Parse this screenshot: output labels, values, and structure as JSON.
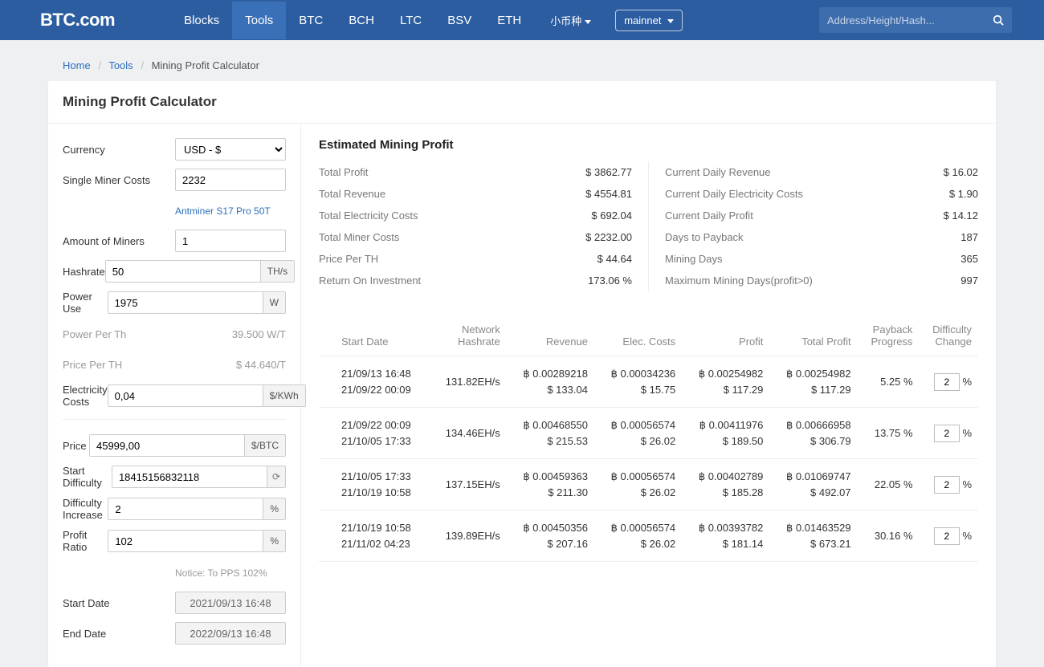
{
  "nav": {
    "logo": "BTC.com",
    "items": [
      "Blocks",
      "Tools",
      "BTC",
      "BCH",
      "LTC",
      "BSV",
      "ETH"
    ],
    "active_index": 1,
    "small_coins": "小币种",
    "network": "mainnet",
    "search_placeholder": "Address/Height/Hash..."
  },
  "crumbs": {
    "home": "Home",
    "tools": "Tools",
    "current": "Mining Profit Calculator"
  },
  "page_title": "Mining Profit Calculator",
  "form": {
    "labels": {
      "currency": "Currency",
      "single_miner_costs": "Single Miner Costs",
      "amount_of_miners": "Amount of Miners",
      "hashrate": "Hashrate",
      "power_use": "Power Use",
      "power_per_th": "Power Per Th",
      "price_per_th": "Price Per TH",
      "electricity_costs": "Electricity Costs",
      "price": "Price",
      "start_difficulty": "Start Difficulty",
      "difficulty_increase": "Difficulty Increase",
      "profit_ratio": "Profit Ratio",
      "start_date": "Start Date",
      "end_date": "End Date"
    },
    "units": {
      "ths": "TH/s",
      "w": "W",
      "kwh": "$/KWh",
      "btc": "$/BTC",
      "pct": "%"
    },
    "values": {
      "currency": "USD - $",
      "single_miner_costs": "2232",
      "amount_of_miners": "1",
      "hashrate": "50",
      "power_use": "1975",
      "power_per_th": "39.500 W/T",
      "price_per_th": "$ 44.640/T",
      "electricity_costs": "0,04",
      "price": "45999,00",
      "start_difficulty": "18415156832118",
      "difficulty_increase": "2",
      "profit_ratio": "102",
      "start_date": "2021/09/13 16:48",
      "end_date": "2022/09/13 16:48"
    },
    "miner_link": "Antminer S17 Pro 50T",
    "notice": "Notice: To PPS 102%"
  },
  "estimated": {
    "title": "Estimated Mining Profit",
    "left": [
      {
        "lab": "Total Profit",
        "val": "$ 3862.77"
      },
      {
        "lab": "Total Revenue",
        "val": "$ 4554.81"
      },
      {
        "lab": "Total Electricity Costs",
        "val": "$ 692.04"
      },
      {
        "lab": "Total Miner Costs",
        "val": "$ 2232.00"
      },
      {
        "lab": "Price Per TH",
        "val": "$ 44.64"
      },
      {
        "lab": "Return On Investment",
        "val": "173.06 %"
      }
    ],
    "right": [
      {
        "lab": "Current Daily Revenue",
        "val": "$ 16.02"
      },
      {
        "lab": "Current Daily Electricity Costs",
        "val": "$ 1.90"
      },
      {
        "lab": "Current Daily Profit",
        "val": "$ 14.12"
      },
      {
        "lab": "Days to Payback",
        "val": "187"
      },
      {
        "lab": "Mining Days",
        "val": "365"
      },
      {
        "lab": "Maximum Mining Days(profit>0)",
        "val": "997"
      }
    ]
  },
  "table": {
    "headers": [
      "Start Date",
      "Network Hashrate",
      "Revenue",
      "Elec. Costs",
      "Profit",
      "Total Profit",
      "Payback Progress",
      "Difficulty Change"
    ],
    "diff_unit": "%",
    "rows": [
      {
        "d1": "21/09/13 16:48",
        "d2": "21/09/22 00:09",
        "hr": "131.82EH/s",
        "rev_b": "฿ 0.00289218",
        "rev_u": "$ 133.04",
        "ec_b": "฿ 0.00034236",
        "ec_u": "$ 15.75",
        "pr_b": "฿ 0.00254982",
        "pr_u": "$ 117.29",
        "tp_b": "฿ 0.00254982",
        "tp_u": "$ 117.29",
        "pb": "5.25 %",
        "dc": "2"
      },
      {
        "d1": "21/09/22 00:09",
        "d2": "21/10/05 17:33",
        "hr": "134.46EH/s",
        "rev_b": "฿ 0.00468550",
        "rev_u": "$ 215.53",
        "ec_b": "฿ 0.00056574",
        "ec_u": "$ 26.02",
        "pr_b": "฿ 0.00411976",
        "pr_u": "$ 189.50",
        "tp_b": "฿ 0.00666958",
        "tp_u": "$ 306.79",
        "pb": "13.75 %",
        "dc": "2"
      },
      {
        "d1": "21/10/05 17:33",
        "d2": "21/10/19 10:58",
        "hr": "137.15EH/s",
        "rev_b": "฿ 0.00459363",
        "rev_u": "$ 211.30",
        "ec_b": "฿ 0.00056574",
        "ec_u": "$ 26.02",
        "pr_b": "฿ 0.00402789",
        "pr_u": "$ 185.28",
        "tp_b": "฿ 0.01069747",
        "tp_u": "$ 492.07",
        "pb": "22.05 %",
        "dc": "2"
      },
      {
        "d1": "21/10/19 10:58",
        "d2": "21/11/02 04:23",
        "hr": "139.89EH/s",
        "rev_b": "฿ 0.00450356",
        "rev_u": "$ 207.16",
        "ec_b": "฿ 0.00056574",
        "ec_u": "$ 26.02",
        "pr_b": "฿ 0.00393782",
        "pr_u": "$ 181.14",
        "tp_b": "฿ 0.01463529",
        "tp_u": "$ 673.21",
        "pb": "30.16 %",
        "dc": "2"
      }
    ]
  }
}
